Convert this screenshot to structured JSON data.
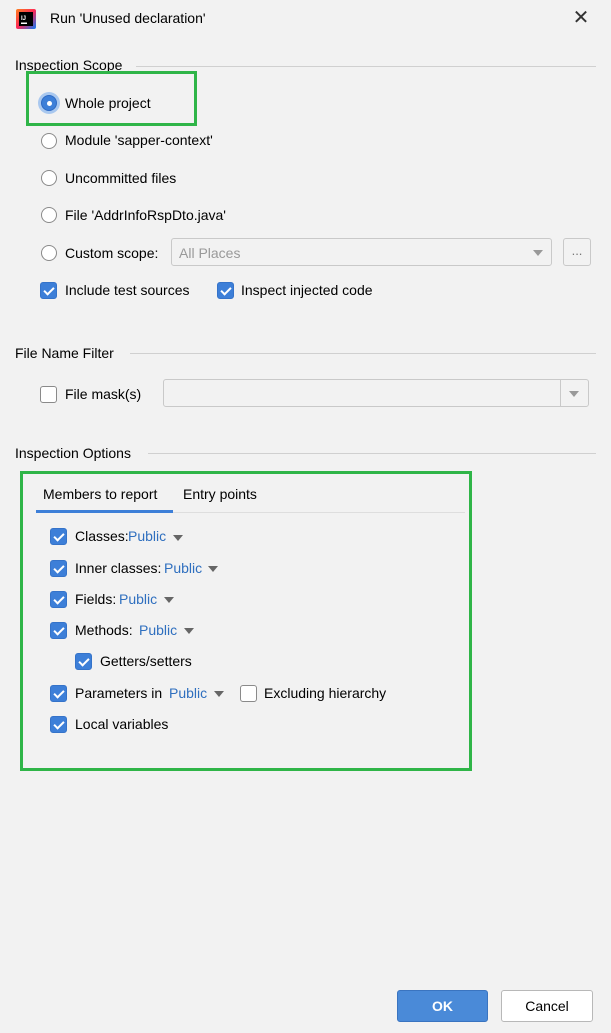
{
  "window": {
    "title": "Run 'Unused declaration'",
    "app_icon": "intellij-idea-icon",
    "close_icon": "close-icon"
  },
  "scope": {
    "heading": "Inspection Scope",
    "options": [
      {
        "label": "Whole project",
        "selected": true
      },
      {
        "label": "Module 'sapper-context'",
        "selected": false
      },
      {
        "label": "Uncommitted files",
        "selected": false
      },
      {
        "label": "File 'AddrInfoRspDto.java'",
        "selected": false
      },
      {
        "label": "Custom scope:",
        "selected": false
      }
    ],
    "custom_scope_value": "All Places",
    "browse_label": "...",
    "include_test_sources": {
      "label": "Include test sources",
      "checked": true
    },
    "inspect_injected_code": {
      "label": "Inspect injected code",
      "checked": true
    }
  },
  "filter": {
    "heading": "File Name Filter",
    "file_mask": {
      "label": "File mask(s)",
      "checked": false,
      "value": ""
    }
  },
  "options": {
    "heading": "Inspection Options",
    "tabs": [
      {
        "label": "Members to report",
        "active": true
      },
      {
        "label": "Entry points",
        "active": false
      }
    ],
    "members": [
      {
        "label": "Classes:",
        "checked": true,
        "visibility": "Public"
      },
      {
        "label": "Inner classes:",
        "checked": true,
        "visibility": "Public"
      },
      {
        "label": "Fields:",
        "checked": true,
        "visibility": "Public"
      },
      {
        "label": "Methods:",
        "checked": true,
        "visibility": "Public"
      },
      {
        "label": "Getters/setters",
        "checked": true
      },
      {
        "label": "Parameters in",
        "checked": true,
        "visibility": "Public"
      },
      {
        "label": "Excluding hierarchy",
        "checked": false
      },
      {
        "label": "Local variables",
        "checked": true
      }
    ]
  },
  "buttons": {
    "ok": "OK",
    "cancel": "Cancel"
  },
  "colors": {
    "accent": "#3d7fd8",
    "link": "#2f6fbf",
    "highlight": "#2fb548",
    "background": "#f2f2f2"
  }
}
